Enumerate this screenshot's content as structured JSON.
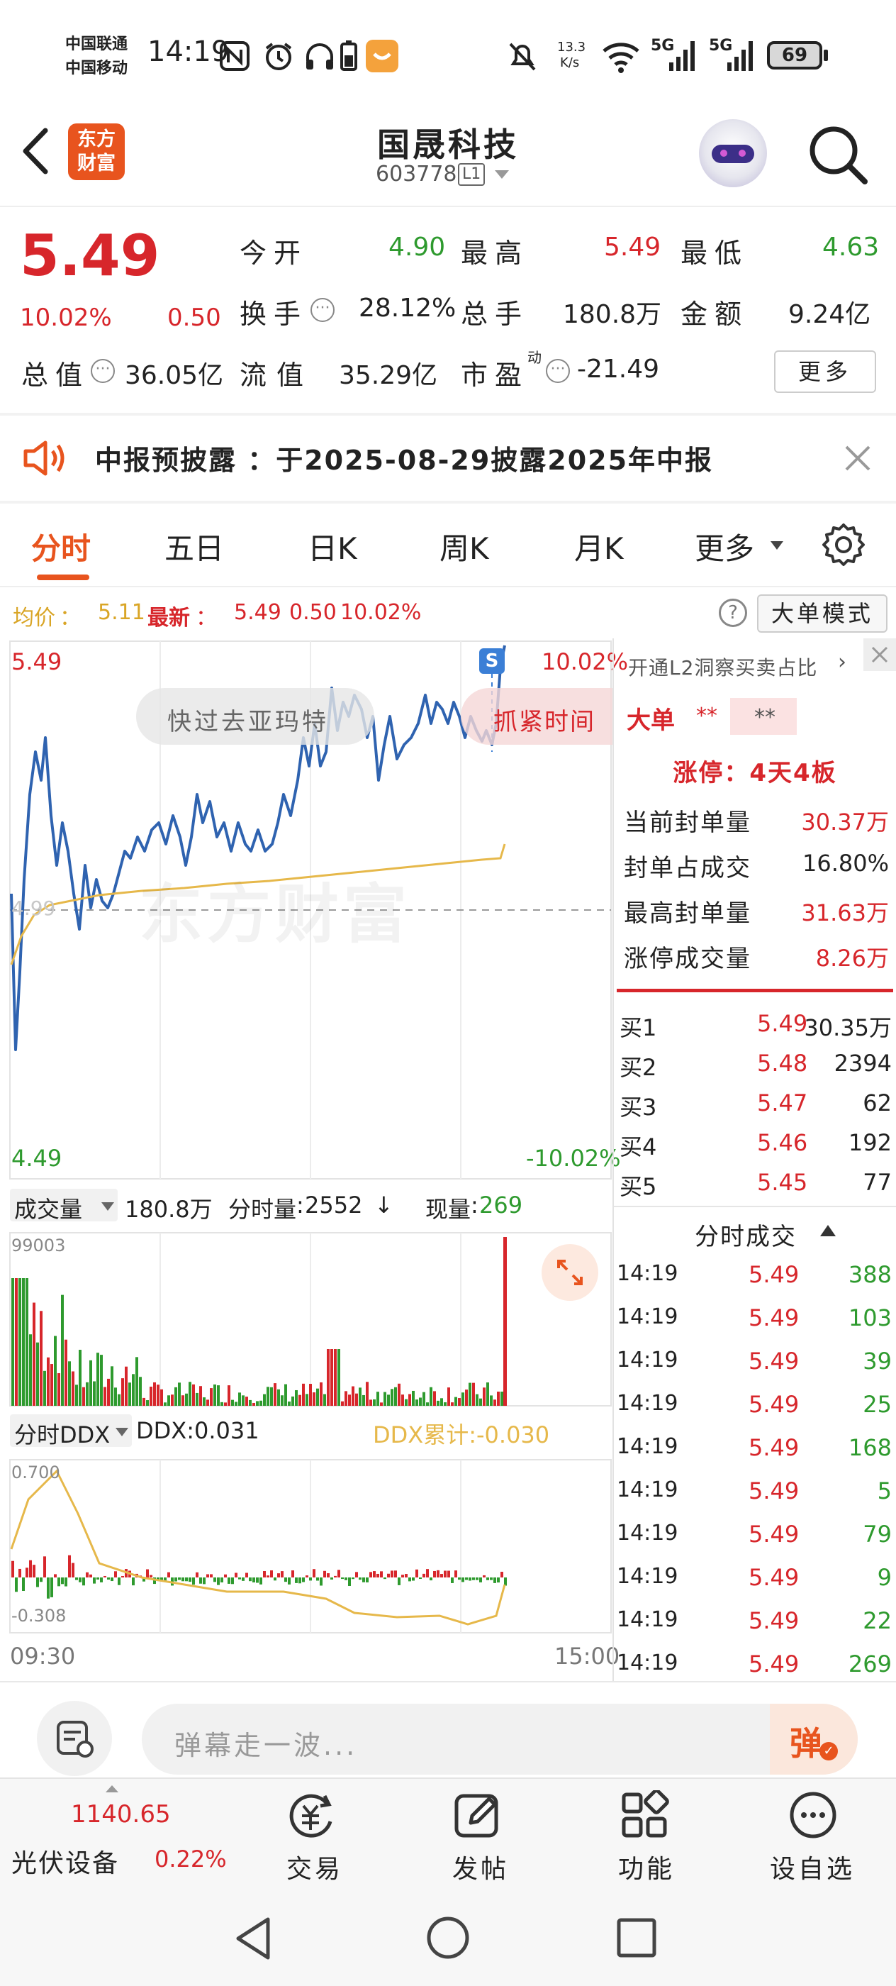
{
  "status": {
    "carrier1": "中国联通",
    "carrier2": "中国移动",
    "time": "14:19",
    "net_speed_top": "13.3",
    "net_speed_bottom": "K/s",
    "sig1": "5G",
    "sig2": "5G",
    "battery": "69"
  },
  "header": {
    "logo_line1": "东方",
    "logo_line2": "财富",
    "title": "国晟科技",
    "code": "603778",
    "l1_badge": "L1"
  },
  "quote": {
    "price": "5.49",
    "change_pct": "10.02%",
    "change": "0.50",
    "items": [
      {
        "label": "今开",
        "value": "4.90",
        "color": "green"
      },
      {
        "label": "最高",
        "value": "5.49",
        "color": "red"
      },
      {
        "label": "最低",
        "value": "4.63",
        "color": "green"
      },
      {
        "label": "换手",
        "value": "28.12%",
        "color": "dark"
      },
      {
        "label": "总手",
        "value": "180.8万",
        "color": "dark"
      },
      {
        "label": "金额",
        "value": "9.24亿",
        "color": "dark"
      },
      {
        "label": "总值",
        "value": "36.05亿",
        "color": "dark"
      },
      {
        "label": "流值",
        "value": "35.29亿",
        "color": "dark"
      },
      {
        "label": "市盈",
        "value": "-21.49",
        "color": "dark",
        "sup": "动"
      }
    ],
    "more_label": "更多"
  },
  "notice": {
    "text": "中报预披露 ：于2025-08-29披露2025年中报"
  },
  "tabs": [
    "分时",
    "五日",
    "日K",
    "周K",
    "月K",
    "更多"
  ],
  "chart_header": {
    "avg_label": "均价",
    "avg_value": "5.11",
    "latest_label": "最新",
    "latest_value": "5.49",
    "latest_change": "0.50",
    "latest_pct": "10.02%",
    "mode_label": "大单模式"
  },
  "chart_labels": {
    "top_price": "5.49",
    "top_pct": "10.02%",
    "bottom_price": "4.49",
    "bottom_pct": "-10.02%",
    "mid_label": "4.99",
    "time_start": "09:30",
    "time_end": "15:00",
    "overlay1": "快过去亚玛特",
    "overlay2": "抓紧时间",
    "watermark": "东方财富",
    "s_badge": "S"
  },
  "volume": {
    "selector": "成交量",
    "total": "180.8万",
    "per_min_label": "分时量",
    "per_min_value": "2552",
    "cur_label": "现量",
    "cur_value": "269",
    "max_label": "99003"
  },
  "ddx": {
    "selector": "分时DDX",
    "ddx_value": "DDX:0.031",
    "ddx_sum": "DDX累计:-0.030",
    "top_label": "0.700",
    "bottom_label": "-0.308"
  },
  "side": {
    "l2_link": "开通L2洞察买卖占比",
    "big_order_label": "大单",
    "big_order_v1": "**",
    "big_order_v2": "**",
    "limit_up": "涨停：4天4板",
    "stats": [
      {
        "label": "当前封单量",
        "value": "30.37万"
      },
      {
        "label": "封单占成交",
        "value": "16.80%"
      },
      {
        "label": "最高封单量",
        "value": "31.63万"
      },
      {
        "label": "涨停成交量",
        "value": "8.26万"
      }
    ],
    "bids": [
      {
        "label": "买1",
        "price": "5.49",
        "vol": "30.35万"
      },
      {
        "label": "买2",
        "price": "5.48",
        "vol": "2394"
      },
      {
        "label": "买3",
        "price": "5.47",
        "vol": "62"
      },
      {
        "label": "买4",
        "price": "5.46",
        "vol": "192"
      },
      {
        "label": "买5",
        "price": "5.45",
        "vol": "77"
      }
    ],
    "trades_title": "分时成交",
    "trades": [
      {
        "t": "14:19",
        "p": "5.49",
        "v": "388"
      },
      {
        "t": "14:19",
        "p": "5.49",
        "v": "103"
      },
      {
        "t": "14:19",
        "p": "5.49",
        "v": "39"
      },
      {
        "t": "14:19",
        "p": "5.49",
        "v": "25"
      },
      {
        "t": "14:19",
        "p": "5.49",
        "v": "168"
      },
      {
        "t": "14:19",
        "p": "5.49",
        "v": "5"
      },
      {
        "t": "14:19",
        "p": "5.49",
        "v": "79"
      },
      {
        "t": "14:19",
        "p": "5.49",
        "v": "9"
      },
      {
        "t": "14:19",
        "p": "5.49",
        "v": "22"
      },
      {
        "t": "14:19",
        "p": "5.49",
        "v": "269"
      }
    ]
  },
  "comment": {
    "placeholder": "弹幕走一波...",
    "danmu_btn": "弹"
  },
  "bottom_nav": {
    "index_value": "1140.65",
    "index_name": "光伏设备",
    "index_pct": "0.22%",
    "items": [
      "交易",
      "发帖",
      "功能",
      "设自选"
    ]
  },
  "colors": {
    "red": "#d7262b",
    "green": "#2e9a2e",
    "accent": "#e8541e",
    "price_line": "#2f63b0",
    "avg_line": "#e6b84a"
  }
}
